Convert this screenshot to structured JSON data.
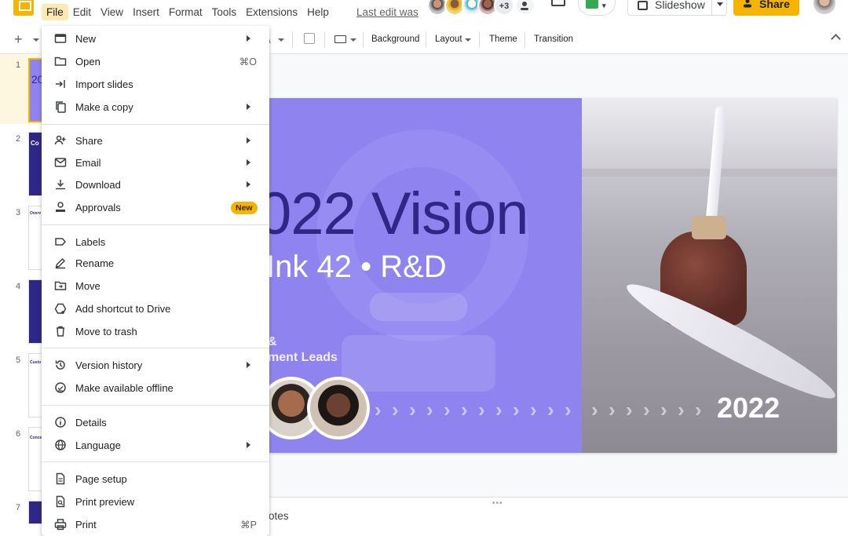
{
  "menubar": {
    "items": [
      "File",
      "Edit",
      "View",
      "Insert",
      "Format",
      "Tools",
      "Extensions",
      "Help"
    ],
    "last_edit": "Last edit was"
  },
  "collaborators": {
    "more_count": "+3"
  },
  "header": {
    "slideshow_label": "Slideshow",
    "share_label": "Share"
  },
  "toolbar": {
    "background": "Background",
    "layout": "Layout",
    "theme": "Theme",
    "transition": "Transition"
  },
  "filmstrip": {
    "slide_numbers": [
      "1",
      "2",
      "3",
      "4",
      "5",
      "6",
      "7"
    ],
    "thumb_texts": [
      "20",
      "Co",
      "Overv",
      "",
      "Custo",
      "Conce",
      ""
    ]
  },
  "slide": {
    "title": "022 Vision",
    "subtitle": "Ink 42 • R&D",
    "role_line1": "&",
    "role_line2": "ment Leads",
    "year": "2022"
  },
  "notes": {
    "label": "otes"
  },
  "file_menu": {
    "items": [
      {
        "label": "New",
        "icon": "new-icon",
        "submenu": true
      },
      {
        "label": "Open",
        "icon": "folder-icon",
        "shortcut": "⌘O"
      },
      {
        "label": "Import slides",
        "icon": "import-icon"
      },
      {
        "label": "Make a copy",
        "icon": "copy-icon",
        "submenu": true
      },
      {
        "label": "Share",
        "icon": "person-add-icon",
        "submenu": true
      },
      {
        "label": "Email",
        "icon": "email-icon",
        "submenu": true
      },
      {
        "label": "Download",
        "icon": "download-icon",
        "submenu": true
      },
      {
        "label": "Approvals",
        "icon": "approvals-icon",
        "badge": "New"
      },
      {
        "label": "Labels",
        "icon": "label-icon"
      },
      {
        "label": "Rename",
        "icon": "rename-icon"
      },
      {
        "label": "Move",
        "icon": "move-icon"
      },
      {
        "label": "Add shortcut to Drive",
        "icon": "drive-shortcut-icon"
      },
      {
        "label": "Move to trash",
        "icon": "trash-icon"
      },
      {
        "label": "Version history",
        "icon": "history-icon",
        "submenu": true
      },
      {
        "label": "Make available offline",
        "icon": "offline-icon"
      },
      {
        "label": "Details",
        "icon": "info-icon"
      },
      {
        "label": "Language",
        "icon": "globe-icon",
        "submenu": true
      },
      {
        "label": "Page setup",
        "icon": "page-setup-icon"
      },
      {
        "label": "Print preview",
        "icon": "print-preview-icon"
      },
      {
        "label": "Print",
        "icon": "print-icon",
        "shortcut": "⌘P"
      }
    ]
  },
  "colors": {
    "accent": "#f5b400",
    "slide_bg": "#8f83f0",
    "title_color": "#2f2787"
  }
}
